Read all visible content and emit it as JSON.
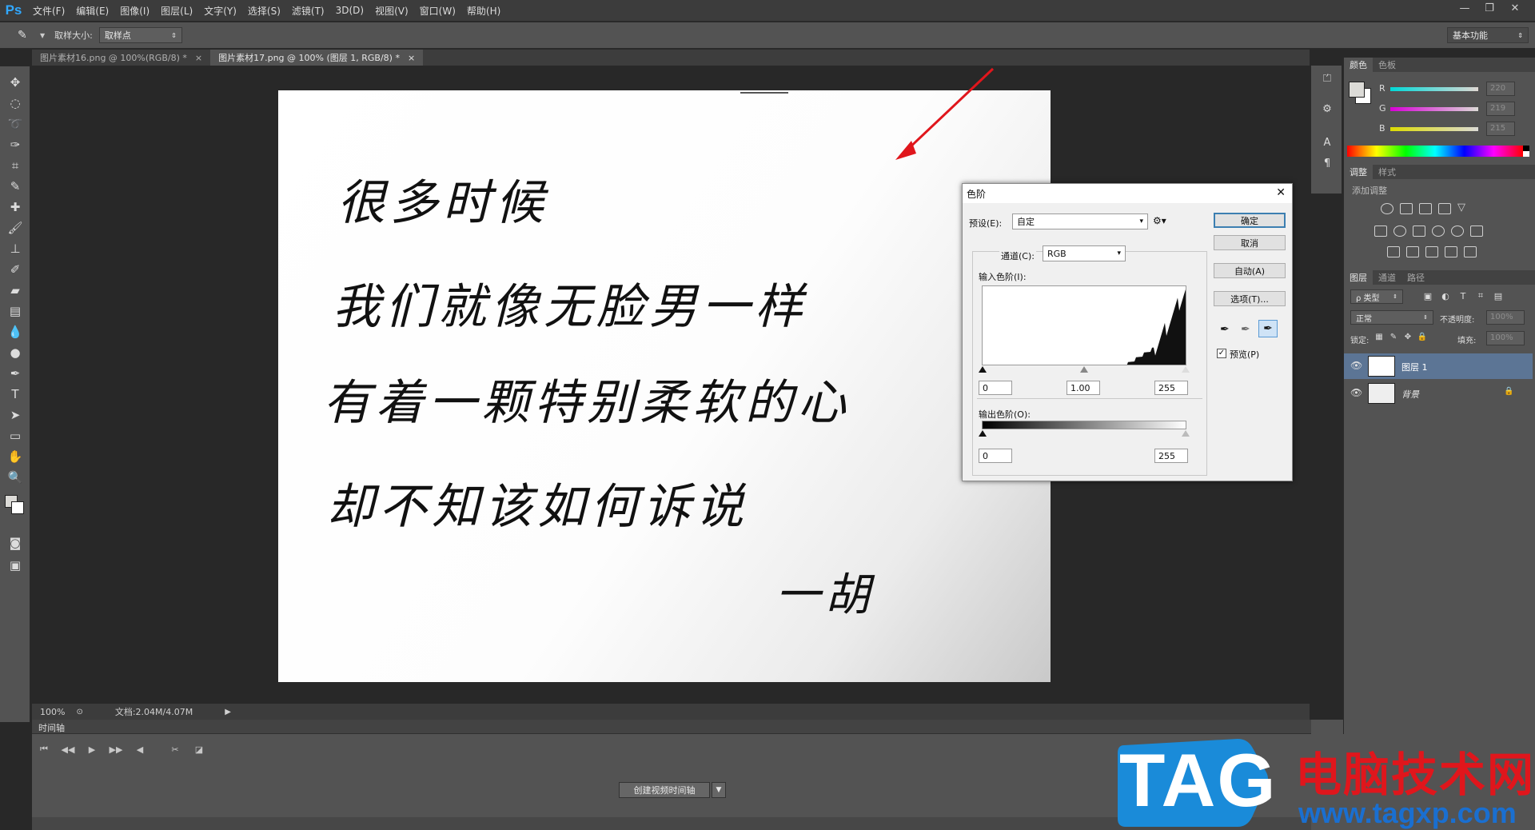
{
  "menu": {
    "logo": "Ps",
    "items": [
      "文件(F)",
      "编辑(E)",
      "图像(I)",
      "图层(L)",
      "文字(Y)",
      "选择(S)",
      "滤镜(T)",
      "3D(D)",
      "视图(V)",
      "窗口(W)",
      "帮助(H)"
    ]
  },
  "options": {
    "sample_size_label": "取样大小:",
    "sample_size_value": "取样点",
    "workspace": "基本功能"
  },
  "tabs": [
    {
      "label": "图片素材16.png @ 100%(RGB/8) *",
      "close": "×"
    },
    {
      "label": "图片素材17.png @ 100% (图层 1, RGB/8) *",
      "close": "×"
    }
  ],
  "canvas": {
    "lines": [
      "很多时候",
      "我们就像无脸男一样",
      "有着一颗特别柔软的心",
      "却不知该如何诉说"
    ],
    "signature": "一胡"
  },
  "status": {
    "zoom": "100%",
    "doc": "文档:2.04M/4.07M"
  },
  "timeline": {
    "title": "时间轴",
    "create_button": "创建视频时间轴"
  },
  "color_panel": {
    "tabs": [
      "颜色",
      "色板"
    ],
    "channels": [
      {
        "label": "R",
        "value": "220"
      },
      {
        "label": "G",
        "value": "219"
      },
      {
        "label": "B",
        "value": "215"
      }
    ]
  },
  "adjust_panel": {
    "tabs": [
      "调整",
      "样式"
    ],
    "add_label": "添加调整"
  },
  "layers_panel": {
    "tabs": [
      "图层",
      "通道",
      "路径"
    ],
    "filter_label": "ρ 类型",
    "blend_mode": "正常",
    "opacity_label": "不透明度:",
    "opacity_value": "100%",
    "lock_label": "锁定:",
    "fill_label": "填充:",
    "fill_value": "100%",
    "layers": [
      {
        "name": "图层 1",
        "selected": true
      },
      {
        "name": "背景",
        "selected": false
      }
    ]
  },
  "levels_dialog": {
    "title": "色阶",
    "preset_label": "预设(E):",
    "preset_value": "自定",
    "channel_label": "通道(C):",
    "channel_value": "RGB",
    "input_label": "输入色阶(I):",
    "input_black": "0",
    "input_gamma": "1.00",
    "input_white": "255",
    "output_label": "输出色阶(O):",
    "output_black": "0",
    "output_white": "255",
    "buttons": {
      "ok": "确定",
      "cancel": "取消",
      "auto": "自动(A)",
      "options": "选项(T)..."
    },
    "preview_label": "预览(P)"
  },
  "watermark": {
    "logo": "TAG",
    "name": "电脑技术网",
    "url": "www.tagxp.com"
  },
  "colors": {
    "accent": "#e0161c",
    "selected_layer": "#5c7595"
  }
}
